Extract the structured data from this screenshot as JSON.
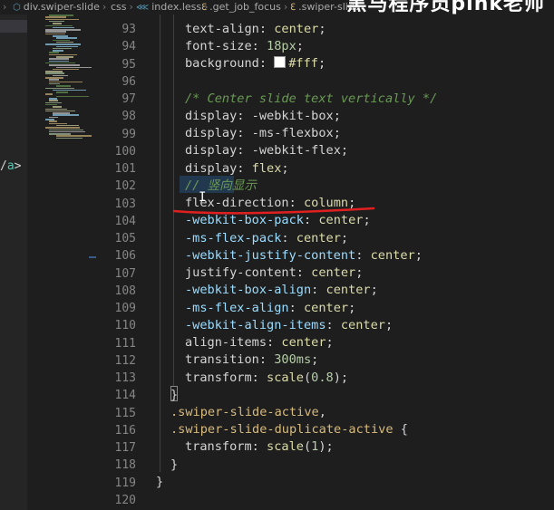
{
  "breadcrumb": {
    "item1": "div.swiper-slide",
    "item2": "css",
    "item3": "index.less",
    "item4": ".get_job_focus",
    "item5": ".swiper-slide"
  },
  "watermark": "黑马程序员pink老师",
  "left_anchor": {
    "slash": "/",
    "tag": "a",
    "close": ">"
  },
  "gutter": [
    "93",
    "94",
    "95",
    "96",
    "97",
    "98",
    "99",
    "100",
    "101",
    "102",
    "103",
    "104",
    "105",
    "106",
    "107",
    "108",
    "109",
    "110",
    "111",
    "112",
    "113",
    "114",
    "115",
    "116",
    "117",
    "118",
    "119",
    "120"
  ],
  "code": {
    "l93": {
      "prop": "text-align",
      "val": "center"
    },
    "l94": {
      "prop": "font-size",
      "val": "18px"
    },
    "l95": {
      "prop": "background",
      "val": "#fff"
    },
    "l97": {
      "comment": "/* Center slide text vertically */"
    },
    "l98": {
      "prop": "display",
      "val": "-webkit-box"
    },
    "l99": {
      "prop": "display",
      "val": "-ms-flexbox"
    },
    "l100": {
      "prop": "display",
      "val": "-webkit-flex"
    },
    "l101": {
      "prop": "display",
      "val": "flex"
    },
    "l102": {
      "comment": "// 竖向显示"
    },
    "l103": {
      "prop": "flex-direction",
      "val": "column"
    },
    "l104": {
      "prop": "-webkit-box-pack",
      "val": "center"
    },
    "l105": {
      "prop": "-ms-flex-pack",
      "val": "center"
    },
    "l106": {
      "prop": "-webkit-justify-content",
      "val": "center"
    },
    "l107": {
      "prop": "justify-content",
      "val": "center"
    },
    "l108": {
      "prop": "-webkit-box-align",
      "val": "center"
    },
    "l109": {
      "prop": "-ms-flex-align",
      "val": "center"
    },
    "l110": {
      "prop": "-webkit-align-items",
      "val": "center"
    },
    "l111": {
      "prop": "align-items",
      "val": "center"
    },
    "l112": {
      "prop": "transition",
      "val": "300ms"
    },
    "l113": {
      "prop": "transform",
      "fn": "scale",
      "arg": "0.8"
    },
    "l114": {
      "text": "}"
    },
    "l115": {
      "selector": ".swiper-slide-active",
      "tail": ","
    },
    "l116": {
      "selector": ".swiper-slide-duplicate-active",
      "tail": " {"
    },
    "l117": {
      "prop": "transform",
      "fn": "scale",
      "arg": "1"
    },
    "l118": {
      "text": "}"
    },
    "l119": {
      "text": "}"
    }
  },
  "colors": {
    "background": "#1e1e1e",
    "property": "#d4d4d4",
    "vendor_property": "#9cdcfe",
    "value": "#dcdcaa",
    "number": "#b5cea8",
    "comment": "#6a9955",
    "selector": "#d7ba7d",
    "annotation": "#e02020"
  }
}
